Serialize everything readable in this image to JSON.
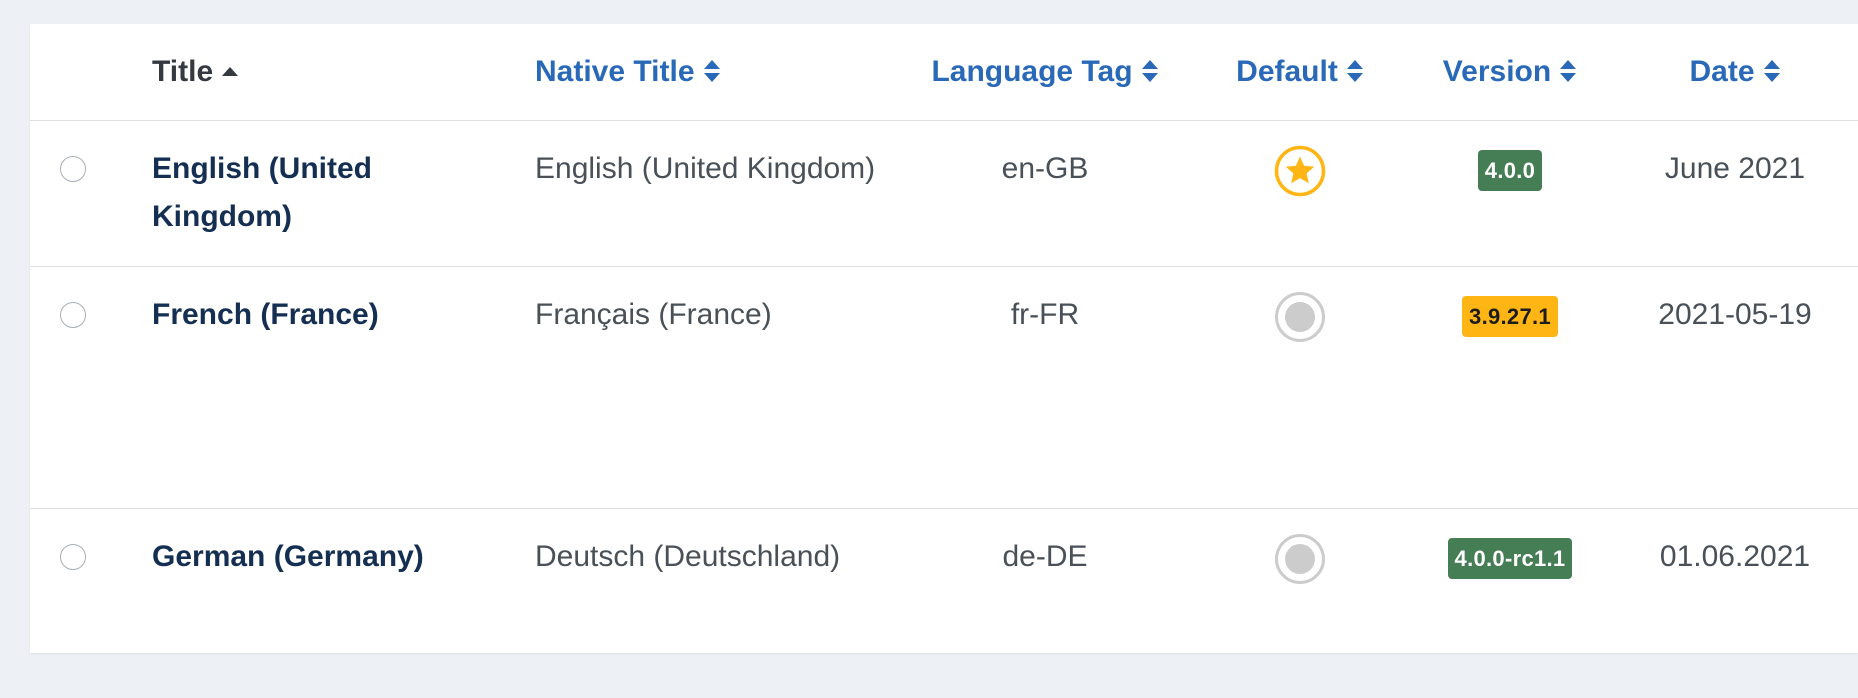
{
  "columns": {
    "title": "Title",
    "native_title": "Native Title",
    "language_tag": "Language Tag",
    "default": "Default",
    "version": "Version",
    "date": "Date"
  },
  "sort": {
    "active_column": "title",
    "direction": "ascending",
    "icons": [
      "caret-up-icon",
      "sort-icon"
    ]
  },
  "colors": {
    "link": "#2a69b8",
    "title_text": "#152f52",
    "badge_green": "#457d54",
    "badge_yellow": "#ffb514",
    "default_star": "#ffb514",
    "inactive_default": "#cccccc",
    "background": "#edf1f5"
  },
  "rows": [
    {
      "title": "English (United Kingdom)",
      "native_title": "English (United Kingdom)",
      "language_tag": "en-GB",
      "is_default": true,
      "default_icon": "star-circle-icon",
      "version": "4.0.0",
      "version_badge": "green",
      "date": "June 2021"
    },
    {
      "title": "French (France)",
      "native_title": "Français (France)",
      "language_tag": "fr-FR",
      "is_default": false,
      "default_icon": "circle-icon",
      "version": "3.9.27.1",
      "version_badge": "yellow",
      "date": "2021-05-19"
    },
    {
      "title": "German (Germany)",
      "native_title": "Deutsch (Deutschland)",
      "language_tag": "de-DE",
      "is_default": false,
      "default_icon": "circle-icon",
      "version": "4.0.0-rc1.1",
      "version_badge": "green",
      "date": "01.06.2021"
    }
  ]
}
